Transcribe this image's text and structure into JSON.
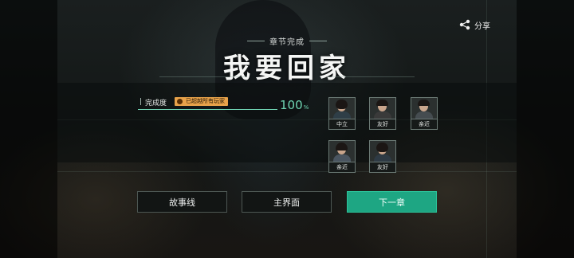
{
  "header": {
    "share_label": "分享",
    "subtitle": "章节完成",
    "title": "我要回家"
  },
  "progress": {
    "label": "完成度",
    "badge": "已超越所有玩家",
    "value_number": "100",
    "value_unit": "%",
    "fraction": 1.0,
    "accent_color": "#6fd1b2",
    "badge_color": "#e8a24a"
  },
  "characters": [
    {
      "relation": "中立"
    },
    {
      "relation": "友好"
    },
    {
      "relation": "亲近"
    },
    {
      "relation": "亲近"
    },
    {
      "relation": "友好"
    }
  ],
  "buttons": {
    "story_line": "故事线",
    "main_menu": "主界面",
    "next_chapter": "下一章",
    "primary_color": "#1ea683"
  }
}
